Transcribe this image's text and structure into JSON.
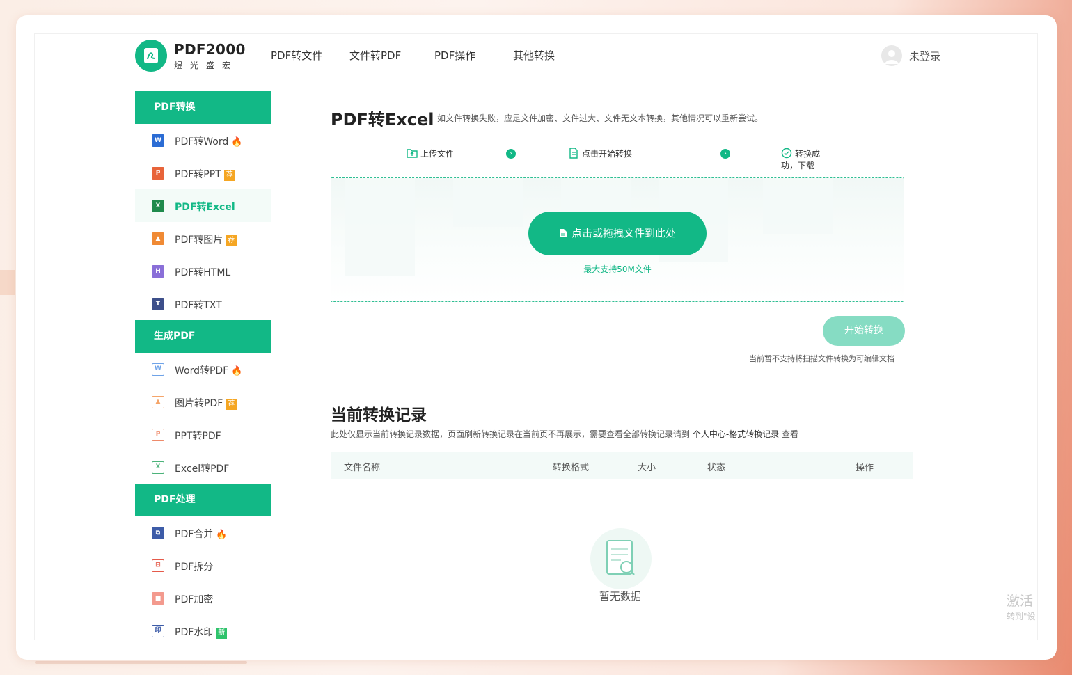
{
  "brand": {
    "name": "PDF2000",
    "sub": "煜光盛宏"
  },
  "nav": {
    "items": [
      "PDF转文件",
      "文件转PDF",
      "PDF操作",
      "其他转换"
    ]
  },
  "user": {
    "label": "未登录"
  },
  "sidebar": {
    "groups": [
      {
        "title": "PDF转换",
        "items": [
          {
            "label": "PDF转Word",
            "icon": "word-icon",
            "tag": "hot"
          },
          {
            "label": "PDF转PPT",
            "icon": "ppt-icon",
            "tag": "荐"
          },
          {
            "label": "PDF转Excel",
            "icon": "excel-icon",
            "active": true
          },
          {
            "label": "PDF转图片",
            "icon": "image-icon",
            "tag": "荐"
          },
          {
            "label": "PDF转HTML",
            "icon": "html-icon"
          },
          {
            "label": "PDF转TXT",
            "icon": "txt-icon"
          }
        ]
      },
      {
        "title": "生成PDF",
        "items": [
          {
            "label": "Word转PDF",
            "icon": "word-to-pdf-icon",
            "tag": "hot"
          },
          {
            "label": "图片转PDF",
            "icon": "image-to-pdf-icon",
            "tag": "荐"
          },
          {
            "label": "PPT转PDF",
            "icon": "ppt-to-pdf-icon"
          },
          {
            "label": "Excel转PDF",
            "icon": "excel-to-pdf-icon"
          }
        ]
      },
      {
        "title": "PDF处理",
        "items": [
          {
            "label": "PDF合并",
            "icon": "merge-icon",
            "tag": "hot"
          },
          {
            "label": "PDF拆分",
            "icon": "split-icon"
          },
          {
            "label": "PDF加密",
            "icon": "lock-icon"
          },
          {
            "label": "PDF水印",
            "icon": "watermark-icon",
            "tag": "新"
          }
        ]
      }
    ]
  },
  "main": {
    "title": "PDF转Excel",
    "hint": "如文件转换失败，应是文件加密、文件过大、文件无文本转换，其他情况可以重新尝试。",
    "steps": [
      "上传文件",
      "点击开始转换",
      "转换成功，下载"
    ],
    "upload_button": "点击或拖拽文件到此处",
    "upload_note": "最大支持50M文件",
    "start_button": "开始转换",
    "start_note": "当前暂不支持将扫描文件转换为可编辑文档"
  },
  "records": {
    "title": "当前转换记录",
    "desc_prefix": "此处仅显示当前转换记录数据，页面刷新转换记录在当前页不再展示，需要查看全部转换记录请到",
    "desc_link": "个人中心-格式转换记录",
    "desc_suffix": "查看",
    "columns": [
      "文件名称",
      "转换格式",
      "大小",
      "状态",
      "操作"
    ],
    "empty_text": "暂无数据"
  },
  "watermark": {
    "line1": "激活",
    "line2": "转到\"设"
  },
  "colors": {
    "accent": "#12b886",
    "accent_light": "#86dcc3",
    "hot": "#f04a2a",
    "recommend": "#f5a623",
    "new": "#2ec36b"
  }
}
